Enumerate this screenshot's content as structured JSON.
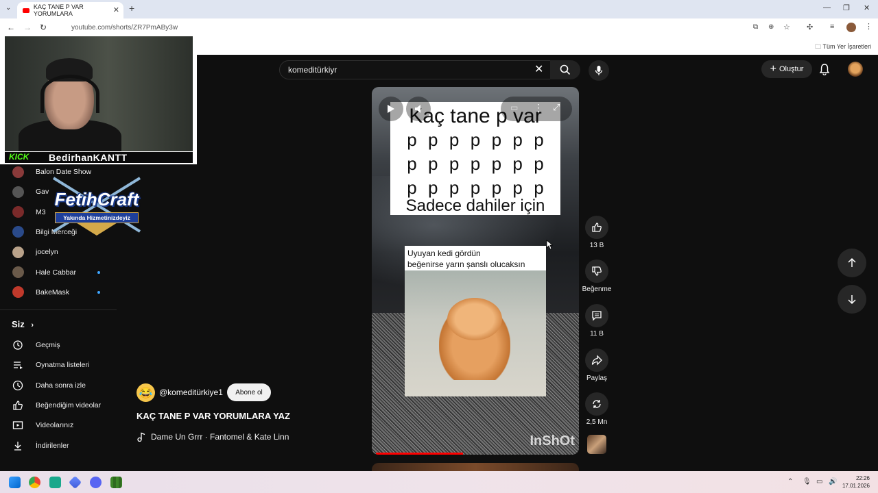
{
  "browser": {
    "tab_title": "KAÇ TANE P VAR YORUMLARA",
    "url": "youtube.com/shorts/ZR7PmABy3w",
    "bookmarks_all": "Tüm Yer İşaretleri"
  },
  "search": {
    "value": "komeditürkiyr"
  },
  "header": {
    "create_label": "Oluştur"
  },
  "sidebar": {
    "subscriptions": [
      {
        "label": "Balon Date Show",
        "color": "#8a3a3a",
        "dot": false
      },
      {
        "label": "Gav",
        "color": "#555555",
        "dot": false
      },
      {
        "label": "M3",
        "color": "#7a2a2a",
        "dot": false
      },
      {
        "label": "Bilgi Merceği",
        "color": "#2a4a8a",
        "dot": false
      },
      {
        "label": "jocelyn",
        "color": "#b9a28a",
        "dot": false
      },
      {
        "label": "Hale Cabbar",
        "color": "#6a5a4a",
        "dot": true
      },
      {
        "label": "BakeMask",
        "color": "#c0392b",
        "dot": true
      }
    ],
    "you_heading": "Siz",
    "menu": [
      {
        "label": "Geçmiş",
        "icon": "history-icon"
      },
      {
        "label": "Oynatma listeleri",
        "icon": "playlist-icon"
      },
      {
        "label": "Daha sonra izle",
        "icon": "clock-icon"
      },
      {
        "label": "Beğendiğim videolar",
        "icon": "like-icon"
      },
      {
        "label": "Videolarınız",
        "icon": "video-icon"
      },
      {
        "label": "İndirilenler",
        "icon": "download-icon"
      }
    ]
  },
  "video": {
    "meme_title": "Kaç tane p var",
    "p_row": [
      "p",
      "p",
      "p",
      "p",
      "p",
      "p",
      "p"
    ],
    "meme_footer": "Sadece dahiler için",
    "cat_line1": "Uyuyan kedi gördün",
    "cat_line2": "beğenirse yarın şanslı olucaksın",
    "watermark": "InShOt",
    "progress_fraction": 0.42
  },
  "channel": {
    "name": "@komeditürkiye1",
    "subscribe_label": "Abone ol",
    "title": "KAÇ TANE P VAR YORUMLARA YAZ",
    "music": "Dame Un Grrr · Fantomel & Kate Linn"
  },
  "actions": {
    "likes": "13 B",
    "dislike_label": "Beğenme",
    "comments": "11 B",
    "share_label": "Paylaş",
    "remix_count": "2,5 Mn"
  },
  "stream_overlay": {
    "platform": "KICK",
    "streamer": "BedirhanKANTT",
    "logo_title": "FetihCraft",
    "logo_subtitle": "Yakında Hizmetinizdeyiz"
  },
  "taskbar": {
    "time": "22:26",
    "date": "17.01.2026"
  }
}
